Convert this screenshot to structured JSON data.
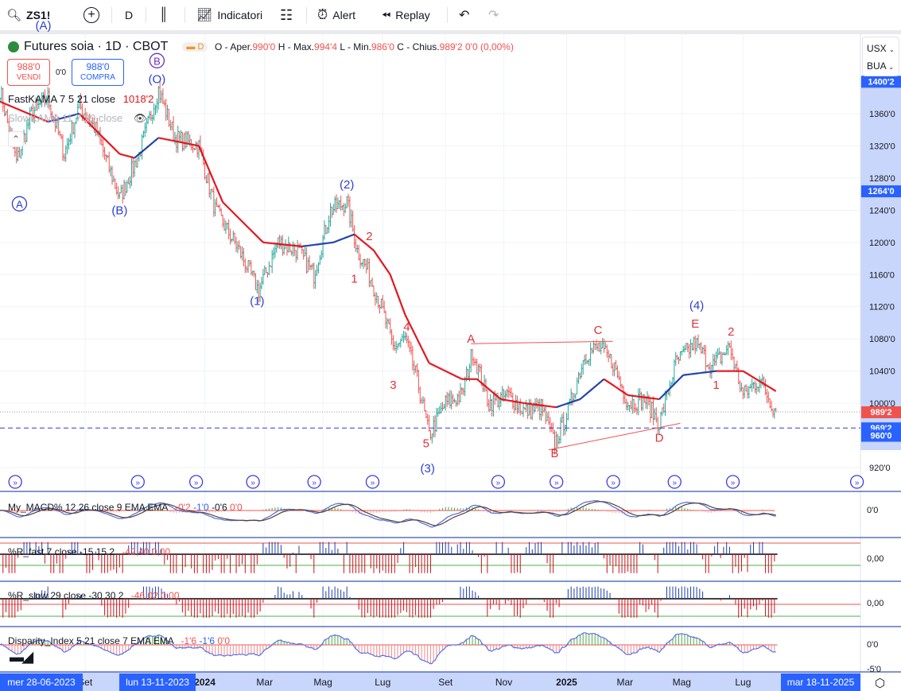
{
  "toolbar": {
    "symbol": "ZS1!",
    "interval": "D",
    "indicators": "Indicatori",
    "alert": "Alert",
    "replay": "Replay"
  },
  "legend": {
    "title": "Futures soia · 1D · CBOT",
    "badge": "D",
    "o_label": "O - Aper.",
    "o": "990'0",
    "h_label": "H - Max.",
    "h": "994'4",
    "l_label": "L - Min.",
    "l": "986'0",
    "c_label": "C - Chius.",
    "c": "989'2",
    "chg": "0'0 (0,00%)"
  },
  "trade": {
    "sell_price": "988'0",
    "sell": "VENDI",
    "spread": "0'0",
    "buy_price": "988'0",
    "buy": "COMPRA"
  },
  "studies": {
    "fastkama": "FastKAMA 7 5 21 close",
    "fastkama_val": "1018'2",
    "slowkama": "SlowKAMA 11 7 29 close"
  },
  "axis": {
    "currency": "USX",
    "unit": "BUA"
  },
  "panes": {
    "macd": {
      "title": "My_MACD% 12 26 close 9 EMA EMA",
      "v1": "-0'2",
      "v2": "-1'0",
      "v3": "-0'6",
      "v4": "0'0",
      "scale": "0'0"
    },
    "rfast": {
      "title": "%R_fast 7 close -15 15 2",
      "v1": "-42,40",
      "v2": "0,00",
      "scale": "0,00"
    },
    "rslow": {
      "title": "%R_slow 29 close -30 30 2",
      "v1": "-46,02",
      "v2": "0,00",
      "scale": "0,00"
    },
    "disp": {
      "title": "Disparity_Index 5 21 close 7 EMA EMA",
      "v1": "-1'6",
      "v2": "-1'6",
      "v3": "0'0",
      "scale": "0'0",
      "scale2": "-5'0"
    }
  },
  "crosshair": {
    "date_left": "mer 28-06-2023",
    "date_mid": "lun 13-11-2023",
    "date_right": "mar 18-11-2025"
  },
  "colors": {
    "up": "#26a69a",
    "down": "#ef5350",
    "kama_down": "#e3121b",
    "kama_up": "#1c3fa8",
    "accent": "#2962ff",
    "wave": "#2f3fd0",
    "minor": "#e0313b"
  },
  "chart_data": {
    "type": "line",
    "title": "Futures soia · 1D · CBOT",
    "xlabel": "",
    "ylabel": "USX/BUA",
    "x_unit": "bar index (trading days from 28-06-2023)",
    "ylim": [
      900,
      1420
    ],
    "grid": true,
    "y_ticks": [
      "1360'0",
      "1320'0",
      "1280'0",
      "1240'0",
      "1200'0",
      "1160'0",
      "1120'0",
      "1080'0",
      "1040'0",
      "1000'0",
      "920'0"
    ],
    "y_tick_values": [
      1360,
      1320,
      1280,
      1240,
      1200,
      1160,
      1120,
      1080,
      1040,
      1000,
      920
    ],
    "price_tags": [
      {
        "label": "1400'2",
        "value": 1400.25,
        "color": "#2962ff"
      },
      {
        "label": "1264'0",
        "value": 1264,
        "color": "#2962ff"
      },
      {
        "label": "989'2",
        "value": 989.25,
        "color": "#ef5350"
      },
      {
        "label": "969'2",
        "value": 969.25,
        "color": "#2962ff"
      },
      {
        "label": "960'0",
        "value": 960,
        "color": "#2962ff"
      }
    ],
    "x_ticks": [
      {
        "bar": 57,
        "label": "Set"
      },
      {
        "bar": 137,
        "label": "2024"
      },
      {
        "bar": 177,
        "label": "Mar"
      },
      {
        "bar": 216,
        "label": "Mag"
      },
      {
        "bar": 256,
        "label": "Lug"
      },
      {
        "bar": 298,
        "label": "Set"
      },
      {
        "bar": 337,
        "label": "Nov"
      },
      {
        "bar": 379,
        "label": "2025"
      },
      {
        "bar": 418,
        "label": "Mar"
      },
      {
        "bar": 456,
        "label": "Mag"
      },
      {
        "bar": 497,
        "label": "Lug"
      }
    ],
    "series": [
      {
        "name": "close",
        "points": [
          [
            0,
            1390
          ],
          [
            11,
            1300
          ],
          [
            21,
            1360
          ],
          [
            32,
            1380
          ],
          [
            43,
            1310
          ],
          [
            53,
            1370
          ],
          [
            64,
            1340
          ],
          [
            80,
            1255
          ],
          [
            93,
            1310
          ],
          [
            106,
            1390
          ],
          [
            117,
            1330
          ],
          [
            133,
            1320
          ],
          [
            144,
            1240
          ],
          [
            160,
            1190
          ],
          [
            173,
            1140
          ],
          [
            186,
            1200
          ],
          [
            199,
            1190
          ],
          [
            210,
            1160
          ],
          [
            221,
            1240
          ],
          [
            232,
            1250
          ],
          [
            239,
            1190
          ],
          [
            247,
            1160
          ],
          [
            255,
            1120
          ],
          [
            263,
            1070
          ],
          [
            271,
            1080
          ],
          [
            279,
            1030
          ],
          [
            287,
            960
          ],
          [
            298,
            1000
          ],
          [
            309,
            1010
          ],
          [
            316,
            1065
          ],
          [
            327,
            1000
          ],
          [
            340,
            1010
          ],
          [
            351,
            990
          ],
          [
            362,
            995
          ],
          [
            371,
            950
          ],
          [
            380,
            990
          ],
          [
            391,
            1060
          ],
          [
            400,
            1070
          ],
          [
            410,
            1050
          ],
          [
            420,
            1000
          ],
          [
            431,
            1005
          ],
          [
            441,
            975
          ],
          [
            452,
            1050
          ],
          [
            465,
            1075
          ],
          [
            476,
            1045
          ],
          [
            488,
            1070
          ],
          [
            497,
            1010
          ],
          [
            508,
            1030
          ],
          [
            519,
            989
          ]
        ]
      },
      {
        "name": "FastKAMA 7 5 21 close",
        "points": [
          [
            0,
            1375
          ],
          [
            32,
            1350
          ],
          [
            53,
            1360
          ],
          [
            80,
            1310
          ],
          [
            90,
            1305
          ],
          [
            106,
            1330
          ],
          [
            133,
            1320
          ],
          [
            149,
            1250
          ],
          [
            176,
            1200
          ],
          [
            202,
            1195
          ],
          [
            223,
            1200
          ],
          [
            237,
            1210
          ],
          [
            250,
            1190
          ],
          [
            261,
            1160
          ],
          [
            271,
            1110
          ],
          [
            287,
            1050
          ],
          [
            309,
            1030
          ],
          [
            319,
            1030
          ],
          [
            335,
            1005
          ],
          [
            351,
            1000
          ],
          [
            372,
            995
          ],
          [
            388,
            1005
          ],
          [
            404,
            1030
          ],
          [
            420,
            1010
          ],
          [
            441,
            1005
          ],
          [
            457,
            1035
          ],
          [
            479,
            1040
          ],
          [
            497,
            1040
          ],
          [
            519,
            1015
          ]
        ]
      }
    ],
    "annotations": [
      {
        "text": "(A)",
        "bar": 29,
        "price": 1465,
        "color": "#2f3fd0"
      },
      {
        "text": "A",
        "bar": 13,
        "price": 1243,
        "color": "#2f3fd0",
        "circled": true
      },
      {
        "text": "B",
        "bar": 105,
        "price": 1421,
        "color": "#6a2fc0",
        "circled": true
      },
      {
        "text": "(O)",
        "bar": 105,
        "price": 1398,
        "color": "#2f3fd0"
      },
      {
        "text": "(B)",
        "bar": 80,
        "price": 1235,
        "color": "#2f3fd0"
      },
      {
        "text": "(1)",
        "bar": 172,
        "price": 1122,
        "color": "#2f3fd0"
      },
      {
        "text": "(2)",
        "bar": 232,
        "price": 1267,
        "color": "#2f3fd0"
      },
      {
        "text": "2",
        "bar": 247,
        "price": 1203,
        "color": "#e0313b"
      },
      {
        "text": "1",
        "bar": 237,
        "price": 1150,
        "color": "#e0313b"
      },
      {
        "text": "4",
        "bar": 272,
        "price": 1090,
        "color": "#e0313b"
      },
      {
        "text": "3",
        "bar": 263,
        "price": 1018,
        "color": "#e0313b"
      },
      {
        "text": "5",
        "bar": 285,
        "price": 945,
        "color": "#e0313b"
      },
      {
        "text": "(3)",
        "bar": 286,
        "price": 914,
        "color": "#2f3fd0"
      },
      {
        "text": "A",
        "bar": 315,
        "price": 1075,
        "color": "#e0313b"
      },
      {
        "text": "B",
        "bar": 371,
        "price": 933,
        "color": "#e0313b"
      },
      {
        "text": "C",
        "bar": 400,
        "price": 1086,
        "color": "#e0313b"
      },
      {
        "text": "D",
        "bar": 441,
        "price": 952,
        "color": "#e0313b"
      },
      {
        "text": "(4)",
        "bar": 466,
        "price": 1117,
        "color": "#2f3fd0"
      },
      {
        "text": "E",
        "bar": 465,
        "price": 1094,
        "color": "#e0313b"
      },
      {
        "text": "2",
        "bar": 489,
        "price": 1084,
        "color": "#e0313b"
      },
      {
        "text": "1",
        "bar": 479,
        "price": 1018,
        "color": "#e0313b"
      }
    ],
    "trendlines": [
      {
        "from": [
          315,
          1074
        ],
        "to": [
          410,
          1077
        ]
      },
      {
        "from": [
          367,
          942
        ],
        "to": [
          455,
          975
        ]
      }
    ],
    "horizontal_lines": [
      {
        "price": 969.25,
        "style": "dashed"
      },
      {
        "price": 989.25,
        "style": "dotted"
      }
    ],
    "event_markers_bars": [
      7,
      89,
      128,
      166,
      207,
      246,
      330,
      369,
      407,
      448,
      487,
      570
    ]
  }
}
